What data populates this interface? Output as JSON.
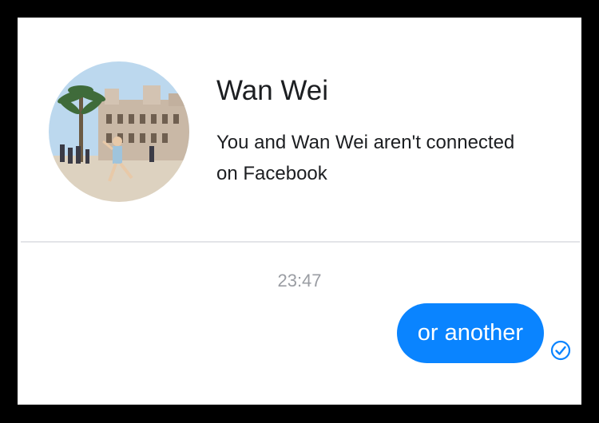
{
  "contact": {
    "name": "Wan Wei",
    "notice": "You and Wan Wei aren't connected on Facebook"
  },
  "thread": {
    "timestamp": "23:47",
    "messages": [
      {
        "text": "or another",
        "sender": "me",
        "status": "sent"
      }
    ]
  },
  "colors": {
    "bubble": "#0a84ff",
    "text": "#1c1e21",
    "timestamp": "#9a9da3"
  },
  "icons": {
    "avatar": "contact-avatar-photo",
    "status": "sent-check-icon"
  }
}
